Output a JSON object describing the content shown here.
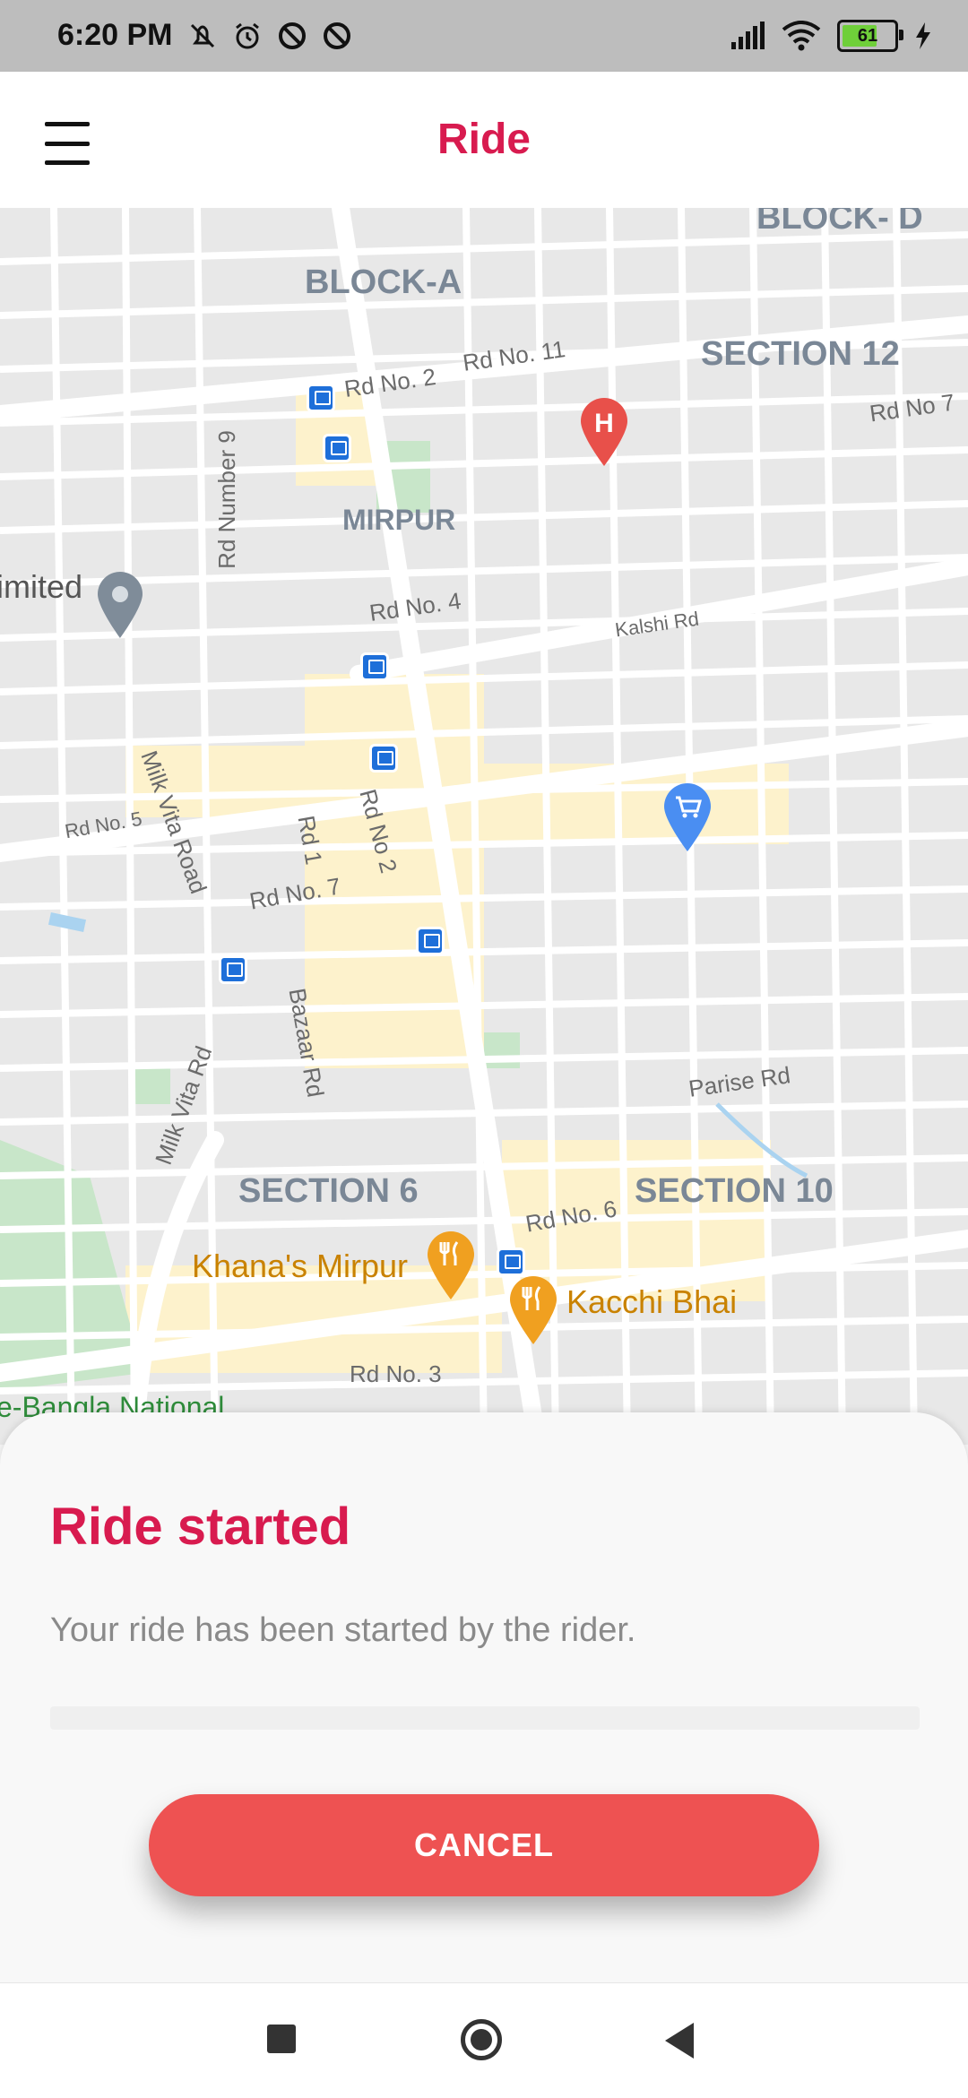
{
  "status_bar": {
    "time": "6:20 PM",
    "battery_level": "61",
    "icons": [
      "mute-icon",
      "alarm-icon",
      "dnd-icon",
      "dnd-icon",
      "signal-icon",
      "wifi-icon",
      "battery-icon",
      "charging-icon"
    ]
  },
  "app_bar": {
    "title": "Ride",
    "menu_icon": "hamburger-menu-icon"
  },
  "map": {
    "areas": [
      "BLOCK- D",
      "BLOCK-A",
      "SECTION 12",
      "MIRPUR",
      "SECTION 6",
      "SECTION 10"
    ],
    "roads": [
      "Rd No. 11",
      "Rd No. 2",
      "Rd No 7",
      "Rd Number 9",
      "Rd No. 4",
      "Kalshi Rd",
      "Milk Vita Road",
      "Rd No. 5",
      "Rd 1",
      "Rd No 2",
      "Rd No. 7",
      "Bazaar Rd",
      "Milk Vita Rd",
      "Parise Rd",
      "Rd No. 6",
      "Rd No. 3"
    ],
    "places": {
      "limited": "imited",
      "khanas": "Khana's Mirpur",
      "kacchi": "Kacchi Bhai",
      "bangla": "e-Bangla National"
    },
    "colors": {
      "area_label": "#7a8796",
      "hospital_pin": "#e8504a",
      "shopping_pin": "#4a8ef2",
      "restaurant_pin": "#f0a020",
      "place_pin": "#7f8c99"
    }
  },
  "sheet": {
    "title": "Ride started",
    "message": "Your ride has been started by the rider.",
    "cancel_label": "CANCEL"
  },
  "nav_bar": {
    "icons": [
      "recents-icon",
      "home-icon",
      "back-icon"
    ]
  },
  "colors": {
    "brand": "#d81b4f",
    "cancel_button": "#ee5252"
  }
}
